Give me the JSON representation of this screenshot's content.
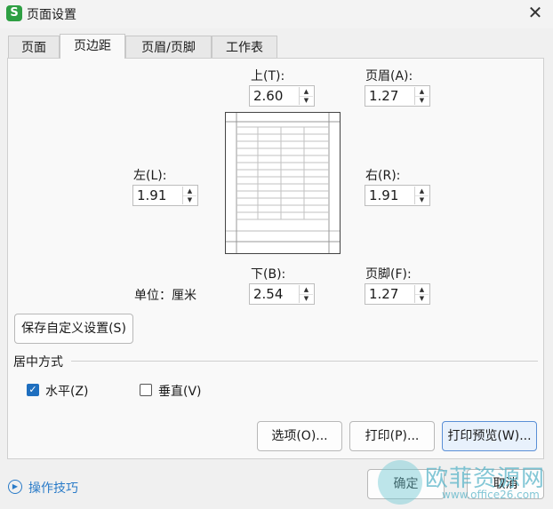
{
  "window": {
    "title": "页面设置",
    "app_icon_letter": "S",
    "close_glyph": "✕"
  },
  "tabs": [
    {
      "label": "页面",
      "active": false
    },
    {
      "label": "页边距",
      "active": true
    },
    {
      "label": "页眉/页脚",
      "active": false
    },
    {
      "label": "工作表",
      "active": false
    }
  ],
  "margins": {
    "top": {
      "label": "上(T):",
      "value": "2.60"
    },
    "header": {
      "label": "页眉(A):",
      "value": "1.27"
    },
    "left": {
      "label": "左(L):",
      "value": "1.91"
    },
    "right": {
      "label": "右(R):",
      "value": "1.91"
    },
    "bottom": {
      "label": "下(B):",
      "value": "2.54"
    },
    "footer": {
      "label": "页脚(F):",
      "value": "1.27"
    }
  },
  "unit_label": "单位：厘米",
  "save_custom_label": "保存自定义设置(S)",
  "center": {
    "group_label": "居中方式",
    "horizontal": {
      "label": "水平(Z)",
      "checked": true
    },
    "vertical": {
      "label": "垂直(V)",
      "checked": false
    }
  },
  "buttons": {
    "options": "选项(O)...",
    "print": "打印(P)...",
    "print_preview": "打印预览(W)...",
    "ok": "确定",
    "cancel": "取消"
  },
  "tips_label": "操作技巧",
  "watermark": {
    "text": "欧菲资源网",
    "sub": "www.office26.com"
  },
  "colors": {
    "accent": "#1f6fbf",
    "app_icon": "#2e9f43",
    "link": "#2a7bc8"
  }
}
